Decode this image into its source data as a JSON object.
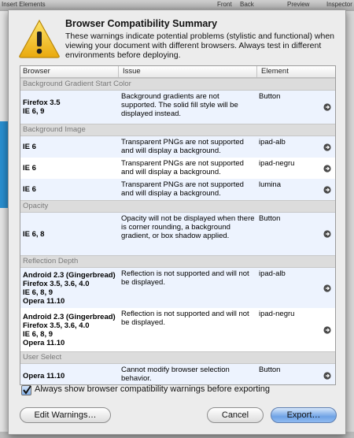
{
  "bg": {
    "toolbar_items": [
      "Insert Elements",
      "Front",
      "Back",
      "Preview",
      "Inspector"
    ]
  },
  "dialog": {
    "title": "Browser Compatibility Summary",
    "description": "These warnings indicate potential problems (stylistic and functional) when viewing your document with different browsers.  Always test in different environments before deploying.",
    "columns": {
      "browser": "Browser",
      "issue": "Issue",
      "element": "Element"
    },
    "groups": [
      {
        "name": "Background Gradient Start Color",
        "rows": [
          {
            "browser": "Firefox 3.5\nIE 6, 9",
            "issue": "Background gradients are not supported. The solid fill style will be displayed instead.",
            "element": "Button"
          }
        ]
      },
      {
        "name": "Background Image",
        "rows": [
          {
            "browser": "IE 6",
            "issue": "Transparent PNGs are not supported and will display a background.",
            "element": "ipad-alb"
          },
          {
            "browser": "IE 6",
            "issue": "Transparent PNGs are not supported and will display a background.",
            "element": "ipad-negru"
          },
          {
            "browser": "IE 6",
            "issue": "Transparent PNGs are not supported and will display a background.",
            "element": "lumina"
          }
        ]
      },
      {
        "name": "Opacity",
        "rows": [
          {
            "browser": "IE 6, 8",
            "issue": "Opacity will not be displayed when there is corner rounding, a background gradient, or box shadow applied.",
            "element": "Button"
          }
        ]
      },
      {
        "name": "Reflection Depth",
        "rows": [
          {
            "browser": "Android 2.3 (Gingerbread)\nFirefox 3.5, 3.6, 4.0\nIE 6, 8, 9\nOpera 11.10",
            "issue": "Reflection is not supported and will not be displayed.",
            "element": "ipad-alb"
          },
          {
            "browser": "Android 2.3 (Gingerbread)\nFirefox 3.5, 3.6, 4.0\nIE 6, 8, 9\nOpera 11.10",
            "issue": "Reflection is not supported and will not be displayed.",
            "element": "ipad-negru"
          }
        ]
      },
      {
        "name": "User Select",
        "rows": [
          {
            "browser": "Opera 11.10",
            "issue": "Cannot modify browser selection behavior.",
            "element": "Button"
          }
        ]
      }
    ],
    "checkbox": {
      "label": "Always show browser compatibility warnings before exporting",
      "checked": true
    },
    "buttons": {
      "edit": "Edit Warnings…",
      "cancel": "Cancel",
      "export": "Export…"
    },
    "colors": {
      "accent": "#6fa3e6",
      "row_alt": "#edf3fe",
      "group_bg": "#dcdcdc",
      "warning": "#f3c21b"
    },
    "icons": {
      "warning": "warning-triangle-icon",
      "row_arrow": "arrow-circle-right-icon"
    }
  }
}
